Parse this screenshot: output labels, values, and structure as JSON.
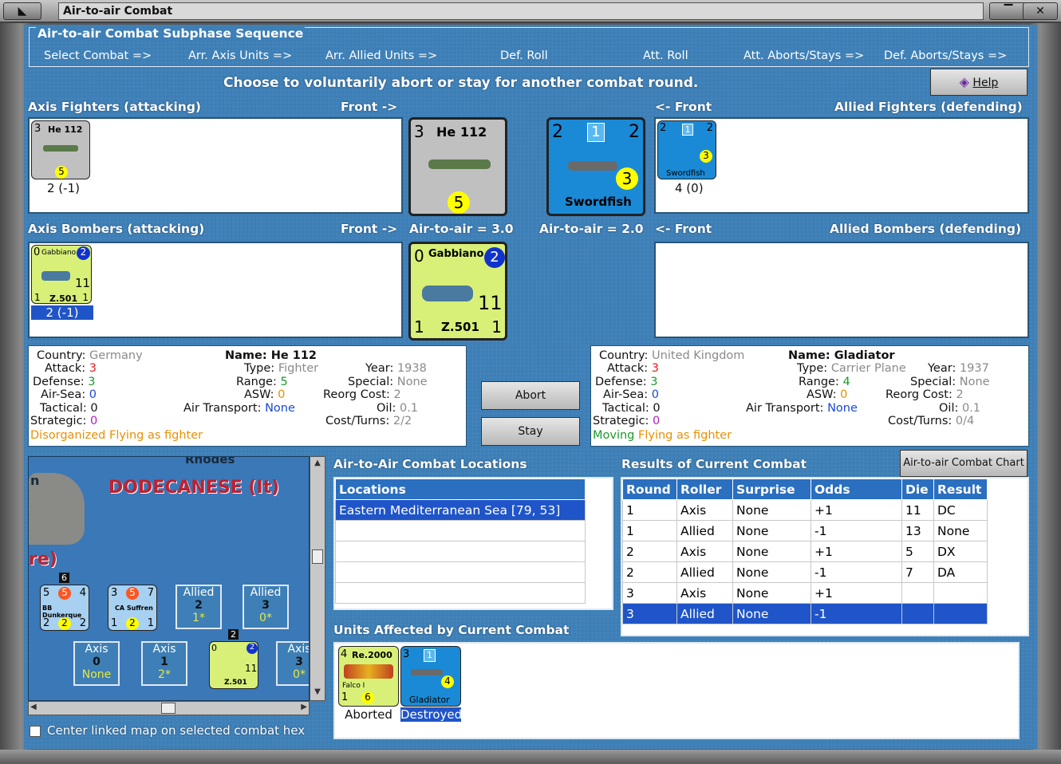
{
  "window": {
    "title": "Air-to-air Combat"
  },
  "sequence": {
    "title": "Air-to-air Combat Subphase Sequence",
    "steps": [
      "Select Combat =>",
      "Arr. Axis Units =>",
      "Arr. Allied Units =>",
      "Def. Roll",
      "Att. Roll",
      "Att. Aborts/Stays =>",
      "Def. Aborts/Stays =>"
    ]
  },
  "instruction": "Choose to voluntarily abort or stay for another combat round.",
  "help_label": "Help",
  "fighters": {
    "axis_label": "Axis Fighters (attacking)",
    "front_right": "Front ->",
    "front_left": "<- Front",
    "allied_label": "Allied Fighters (defending)",
    "axis_unit_value": "2 (-1)",
    "allied_unit_value": "4 (0)",
    "axis_air_to_air": "Air-to-air = 3.0",
    "allied_air_to_air": "Air-to-air = 2.0"
  },
  "bombers": {
    "axis_label": "Axis Bombers (attacking)",
    "front_right": "Front ->",
    "front_left": "<- Front",
    "allied_label": "Allied Bombers (defending)",
    "axis_unit_value": "2 (-1)"
  },
  "counters": {
    "he112": {
      "left": "3",
      "name": "He 112",
      "star": "*",
      "mid": "5"
    },
    "swordfish": {
      "left": "2",
      "mid": "1",
      "right": "2",
      "num": "3",
      "name": "Swordfish",
      "star": "*"
    },
    "gabbiano": {
      "left": "0",
      "name": "Gabbiano",
      "top": "2",
      "num": "11",
      "bl": "1",
      "unit": "Z.501",
      "br": "1"
    },
    "re2000": {
      "left": "4",
      "name": "Re.2000",
      "sub": "Falco I",
      "bl": "1",
      "num": "6",
      "star": "*"
    },
    "gladiator": {
      "left": "3",
      "mid": "1",
      "num": "4",
      "name": "Gladiator",
      "star": "*"
    }
  },
  "axis_info": {
    "country_lbl": "Country:",
    "country": "Germany",
    "name_lbl": "Name:",
    "name": "He 112",
    "attack_lbl": "Attack:",
    "attack": "3",
    "type_lbl": "Type:",
    "type": "Fighter",
    "year_lbl": "Year:",
    "year": "1938",
    "defense_lbl": "Defense:",
    "defense": "3",
    "range_lbl": "Range:",
    "range": "5",
    "special_lbl": "Special:",
    "special": "None",
    "airsea_lbl": "Air-Sea:",
    "airsea": "0",
    "asw_lbl": "ASW:",
    "asw": "0",
    "reorg_lbl": "Reorg Cost:",
    "reorg": "2",
    "tactical_lbl": "Tactical:",
    "tactical": "0",
    "airtrans_lbl": "Air Transport:",
    "airtrans": "None",
    "oil_lbl": "Oil:",
    "oil": "0.1",
    "strategic_lbl": "Strategic:",
    "strategic": "0",
    "cost_lbl": "Cost/Turns:",
    "cost": "2/2",
    "status1": "Disorganized",
    "status2": "Flying as fighter"
  },
  "allied_info": {
    "country_lbl": "Country:",
    "country": "United Kingdom",
    "name_lbl": "Name:",
    "name": "Gladiator",
    "attack_lbl": "Attack:",
    "attack": "3",
    "type_lbl": "Type:",
    "type": "Carrier Plane",
    "year_lbl": "Year:",
    "year": "1937",
    "defense_lbl": "Defense:",
    "defense": "3",
    "range_lbl": "Range:",
    "range": "4",
    "special_lbl": "Special:",
    "special": "None",
    "airsea_lbl": "Air-Sea:",
    "airsea": "0",
    "asw_lbl": "ASW:",
    "asw": "0",
    "reorg_lbl": "Reorg Cost:",
    "reorg": "2",
    "tactical_lbl": "Tactical:",
    "tactical": "0",
    "airtrans_lbl": "Air Transport:",
    "airtrans": "None",
    "oil_lbl": "Oil:",
    "oil": "0.1",
    "strategic_lbl": "Strategic:",
    "strategic": "0",
    "cost_lbl": "Cost/Turns:",
    "cost": "0/4",
    "status1": "Moving",
    "status2": "Flying as fighter"
  },
  "buttons": {
    "abort": "Abort",
    "stay": "Stay",
    "chart": "Air-to-air Combat Chart"
  },
  "map": {
    "region": "DODECANESE (It)",
    "city": "Rhodes",
    "frag_n": "n",
    "frag_re": "re)",
    "stack_num": "6",
    "stack2_num": "2",
    "c1": {
      "a": "5",
      "b": "5",
      "c": "4",
      "name": "BB Dunkerque",
      "d": "2",
      "e": "2",
      "f": "2"
    },
    "c2": {
      "a": "3",
      "b": "5",
      "c": "7",
      "name": "CA Suffren",
      "d": "1",
      "e": "2",
      "f": "1"
    },
    "allied1": {
      "title": "Allied",
      "num": "2",
      "sub": "1*"
    },
    "allied2": {
      "title": "Allied",
      "num": "3",
      "sub": "0*"
    },
    "axis1": {
      "title": "Axis",
      "num": "0",
      "sub": "None"
    },
    "axis2": {
      "title": "Axis",
      "num": "1",
      "sub": "2*"
    },
    "axis3": {
      "title": "Axis",
      "num": "3",
      "sub": "0*"
    },
    "center_label": "Center linked map on selected combat hex"
  },
  "locations": {
    "title": "Air-to-Air Combat Locations",
    "header": "Locations",
    "items": [
      "Eastern Mediterranean Sea [79, 53]"
    ]
  },
  "results": {
    "title": "Results of Current Combat",
    "headers": [
      "Round",
      "Roller",
      "Surprise",
      "Odds",
      "Die",
      "Result"
    ],
    "rows": [
      [
        "1",
        "Axis",
        "None",
        "+1",
        "11",
        "DC"
      ],
      [
        "1",
        "Allied",
        "None",
        "-1",
        "13",
        "None"
      ],
      [
        "2",
        "Axis",
        "None",
        "+1",
        "5",
        "DX"
      ],
      [
        "2",
        "Allied",
        "None",
        "-1",
        "7",
        "DA"
      ],
      [
        "3",
        "Axis",
        "None",
        "+1",
        "",
        ""
      ],
      [
        "3",
        "Allied",
        "None",
        "-1",
        "",
        ""
      ]
    ]
  },
  "affected": {
    "title": "Units Affected by Current Combat",
    "unit1_status": "Aborted",
    "unit2_status": "Destroyed"
  },
  "colors": {
    "panel": "#3d7fb6",
    "header": "#2a6fc0",
    "selected": "#1f55c8",
    "axis_counter": "#c0c0c0",
    "allied_counter": "#1b8ad6",
    "italian_counter": "#d8f078"
  }
}
